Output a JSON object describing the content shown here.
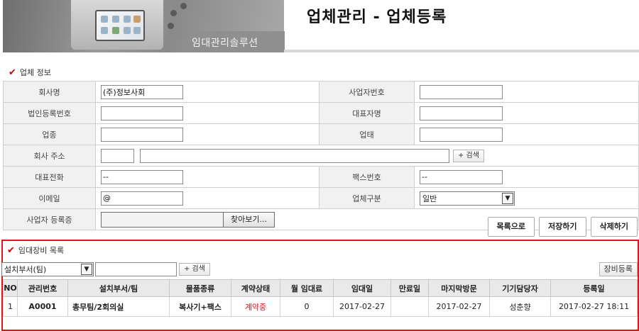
{
  "header": {
    "title": "업체관리 - 업체등록",
    "solution_label": "임대관리솔루션"
  },
  "company_section": {
    "title": "업체 정보",
    "fields": {
      "company_name": {
        "label": "회사명",
        "value": "(주)정보사회"
      },
      "business_no": {
        "label": "사업자번호",
        "value": ""
      },
      "corp_reg_no": {
        "label": "법인등록번호",
        "value": ""
      },
      "ceo_name": {
        "label": "대표자명",
        "value": ""
      },
      "business_type": {
        "label": "업종",
        "value": ""
      },
      "business_item": {
        "label": "업태",
        "value": ""
      },
      "address": {
        "label": "회사 주소",
        "zip": "",
        "detail": "",
        "search_label": "+ 검색"
      },
      "phone": {
        "label": "대표전화",
        "value": "--"
      },
      "fax": {
        "label": "팩스번호",
        "value": "--"
      },
      "email": {
        "label": "이메일",
        "value": "@"
      },
      "company_kind": {
        "label": "업체구분",
        "value": "일반"
      },
      "biz_cert": {
        "label": "사업자 등록증",
        "browse_label": "찾아보기..."
      }
    }
  },
  "actions": {
    "list": "목록으로",
    "save": "저장하기",
    "delete": "삭제하기"
  },
  "rental_section": {
    "title": "임대장비 목록",
    "filter_select": "설치부서(팀)",
    "filter_value": "",
    "search_label": "+ 검색",
    "register_label": "장비등록",
    "columns": [
      "NO",
      "관리번호",
      "설치부서/팀",
      "물품종류",
      "계약상태",
      "월 임대료",
      "임대일",
      "만료일",
      "마지막방문",
      "기기담당자",
      "등록일"
    ],
    "rows": [
      {
        "no": "1",
        "code": "A0001",
        "dept": "총무팀/2회의실",
        "item": "복사기+팩스",
        "status": "계약중",
        "fee": "0",
        "start": "2017-02-27",
        "end": "",
        "last_visit": "2017-02-27",
        "manager": "성춘향",
        "registered": "2017-02-27 18:11"
      }
    ]
  },
  "colors": {
    "accent": "#e0151b",
    "status_active": "#e0151b"
  }
}
